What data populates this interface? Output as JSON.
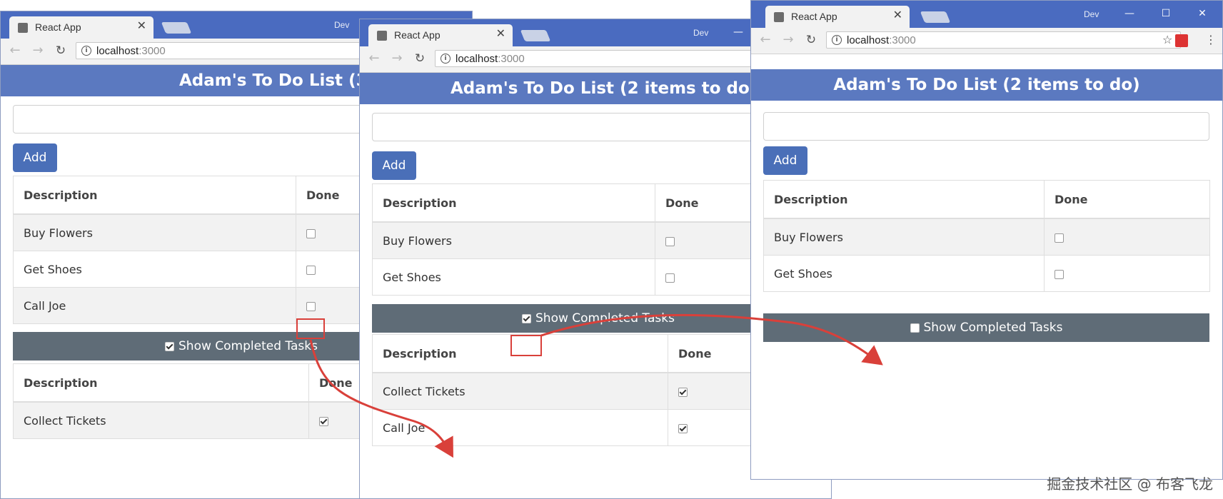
{
  "windows": [
    {
      "tab_title": "React App",
      "close_glyph": "✕",
      "dev_label": "Dev",
      "url_host": "localhost",
      "url_port": ":3000",
      "header": "Adam's To Do List (3 items to do)",
      "add_label": "Add",
      "table1": {
        "headers": [
          "Description",
          "Done"
        ],
        "rows": [
          {
            "text": "Buy Flowers",
            "done": false
          },
          {
            "text": "Get Shoes",
            "done": false
          },
          {
            "text": "Call Joe",
            "done": false
          }
        ]
      },
      "show_completed": {
        "label": "Show Completed Tasks",
        "checked": true
      },
      "table2": {
        "headers": [
          "Description",
          "Done"
        ],
        "rows": [
          {
            "text": "Collect Tickets",
            "done": true
          }
        ]
      }
    },
    {
      "tab_title": "React App",
      "close_glyph": "✕",
      "dev_label": "Dev",
      "url_host": "localhost",
      "url_port": ":3000",
      "header": "Adam's To Do List (2 items to do)",
      "add_label": "Add",
      "table1": {
        "headers": [
          "Description",
          "Done"
        ],
        "rows": [
          {
            "text": "Buy Flowers",
            "done": false
          },
          {
            "text": "Get Shoes",
            "done": false
          }
        ]
      },
      "show_completed": {
        "label": "Show Completed Tasks",
        "checked": true
      },
      "table2": {
        "headers": [
          "Description",
          "Done"
        ],
        "rows": [
          {
            "text": "Collect Tickets",
            "done": true
          },
          {
            "text": "Call Joe",
            "done": true
          }
        ]
      }
    },
    {
      "tab_title": "React App",
      "close_glyph": "✕",
      "dev_label": "Dev",
      "url_host": "localhost",
      "url_port": ":3000",
      "header": "Adam's To Do List (2 items to do)",
      "add_label": "Add",
      "table1": {
        "headers": [
          "Description",
          "Done"
        ],
        "rows": [
          {
            "text": "Buy Flowers",
            "done": false
          },
          {
            "text": "Get Shoes",
            "done": false
          }
        ]
      },
      "show_completed": {
        "label": "Show Completed Tasks",
        "checked": false
      }
    }
  ],
  "icons": {
    "back": "back-arrow-icon",
    "forward": "forward-arrow-icon",
    "reload": "reload-icon",
    "info": "info-icon",
    "star": "star-icon",
    "menu": "menu-dots-icon"
  },
  "colors": {
    "titlebar": "#4a6bc0",
    "header": "#5b79c0",
    "add_button": "#4a6fb8",
    "show_bar": "#5f6c77",
    "highlight": "#d9403a"
  },
  "watermark": "掘金技术社区 @ 布客飞龙"
}
